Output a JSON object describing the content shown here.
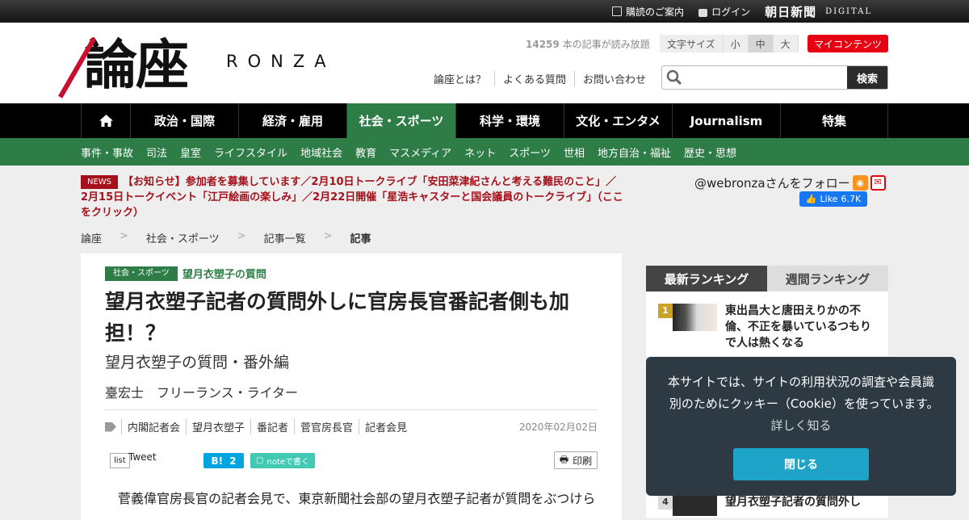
{
  "topbar": {
    "subscribe": "購読のご案内",
    "login": "ログイン",
    "brand": "朝日新聞",
    "brand_sub": "DIGITAL"
  },
  "header": {
    "logo_kanji": "論座",
    "logo_latin": "RONZA",
    "count_num": "14259",
    "count_text": " 本の記事が読み放題",
    "fontsize_label": "文字サイズ",
    "fontsize_small": "小",
    "fontsize_mid": "中",
    "fontsize_large": "大",
    "mycontents": "マイコンテンツ",
    "links": [
      "論座とは？",
      "よくある質問",
      "お問い合わせ"
    ],
    "search_button": "検索",
    "search_placeholder": ""
  },
  "nav": {
    "tabs": [
      "政治・国際",
      "経済・雇用",
      "社会・スポーツ",
      "科学・環境",
      "文化・エンタメ",
      "Journalism",
      "特集"
    ],
    "active_index": 2
  },
  "subnav": [
    "事件・事故",
    "司法",
    "皇室",
    "ライフスタイル",
    "地域社会",
    "教育",
    "マスメディア",
    "ネット",
    "スポーツ",
    "世相",
    "地方自治・福祉",
    "歴史・思想"
  ],
  "news": {
    "badge": "NEWS",
    "text": "【お知らせ】参加者を募集しています／2月10日トークライブ「安田菜津紀さんと考える難民のこと」／2月15日トークイベント「江戸絵画の楽しみ」／2月22日開催「星浩キャスターと国会議員のトークライブ」（ここをクリック）"
  },
  "social": {
    "follow": "@webronzaさんをフォロー",
    "fb_like": "Like",
    "fb_count": "6.7K"
  },
  "breadcrumb": {
    "items": [
      "論座",
      "社会・スポーツ",
      "記事一覧",
      "記事"
    ],
    "sep": ">"
  },
  "article": {
    "category": "社会・スポーツ",
    "series": "望月衣塑子の質問",
    "title": "望月衣塑子記者の質問外しに官房長官番記者側も加担！？",
    "subtitle": "望月衣塑子の質問・番外編",
    "author": "臺宏士　フリーランス・ライター",
    "tags": [
      "内閣記者会",
      "望月衣塑子",
      "番記者",
      "菅官房長官",
      "記者会見"
    ],
    "date": "2020年02月02日",
    "tweet_list": "list",
    "tweet": "Tweet",
    "hatena_count": "2",
    "note": "noteで書く",
    "print": "印刷",
    "body": "菅義偉官房長官の記者会見で、東京新聞社会部の望月衣塑子記者が質問をぶつけら"
  },
  "ranking": {
    "tab_latest": "最新ランキング",
    "tab_weekly": "週間ランキング",
    "item1_num": "1",
    "item1_title": "東出昌大と唐田えりかの不倫、不正を暴いているつもりで人は熱くなる",
    "item4_num": "4",
    "item4_title": "望月衣塑子記者の質問外し"
  },
  "cookie": {
    "message": "本サイトでは、サイトの利用状況の調査や会員識別のためにクッキー（Cookie）を使っています。",
    "more": "詳しく知る",
    "close": "閉じる"
  },
  "colors": {
    "green": "#2e7d46",
    "red": "#e60012",
    "news_red": "#a5101b",
    "cookie_bg": "#2d3a44",
    "cookie_btn": "#1ea4c9"
  }
}
